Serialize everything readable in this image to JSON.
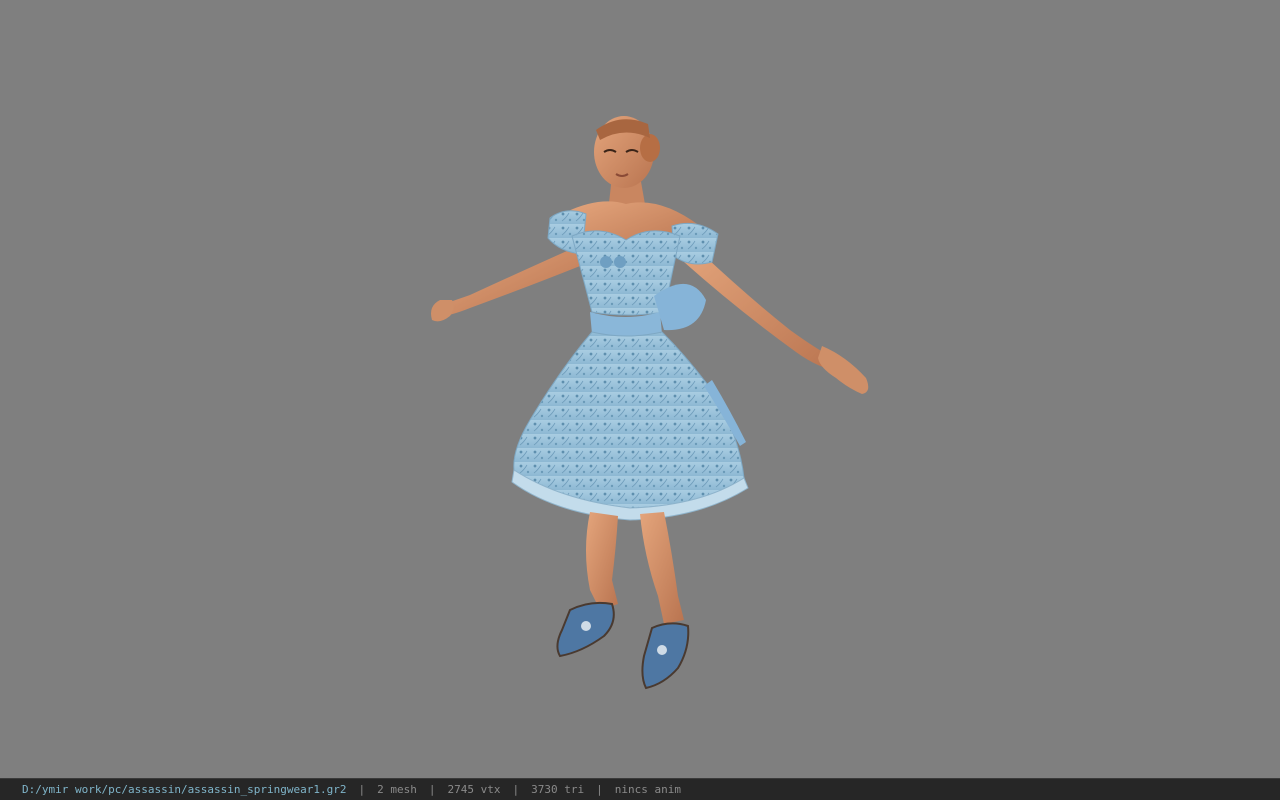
{
  "viewer": {
    "background_color": "#7f7f7f",
    "model_description": "character model in T-pose wearing light blue floral dress"
  },
  "status_bar": {
    "file_path": "D:/ymir work/pc/assassin/assassin_springwear1.gr2",
    "mesh": "2 mesh",
    "vertices": "2745 vtx",
    "triangles": "3730 tri",
    "animation": "nincs anim",
    "separator": "|"
  }
}
